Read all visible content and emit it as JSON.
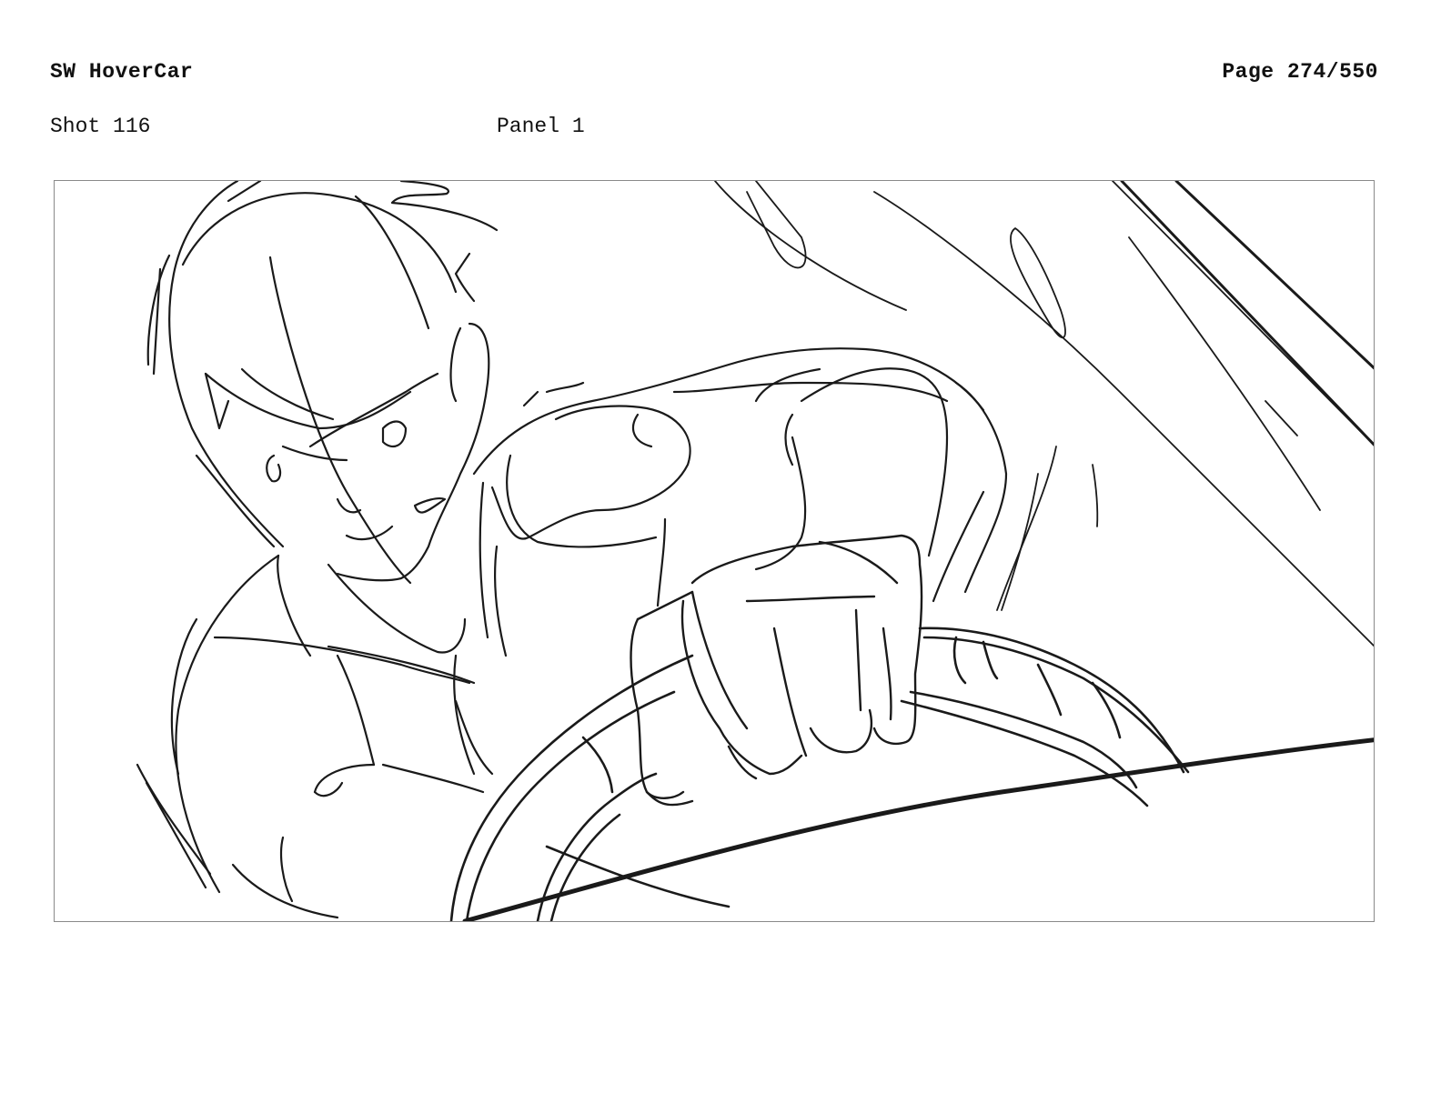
{
  "header": {
    "title": "SW HoverCar",
    "page": "Page 274/550"
  },
  "shot": {
    "label": "Shot 116"
  },
  "panel": {
    "label": "Panel 1"
  },
  "colors": {
    "ink": "#1a1a1a",
    "frame_border": "#8a8a8a",
    "background": "#ffffff"
  }
}
